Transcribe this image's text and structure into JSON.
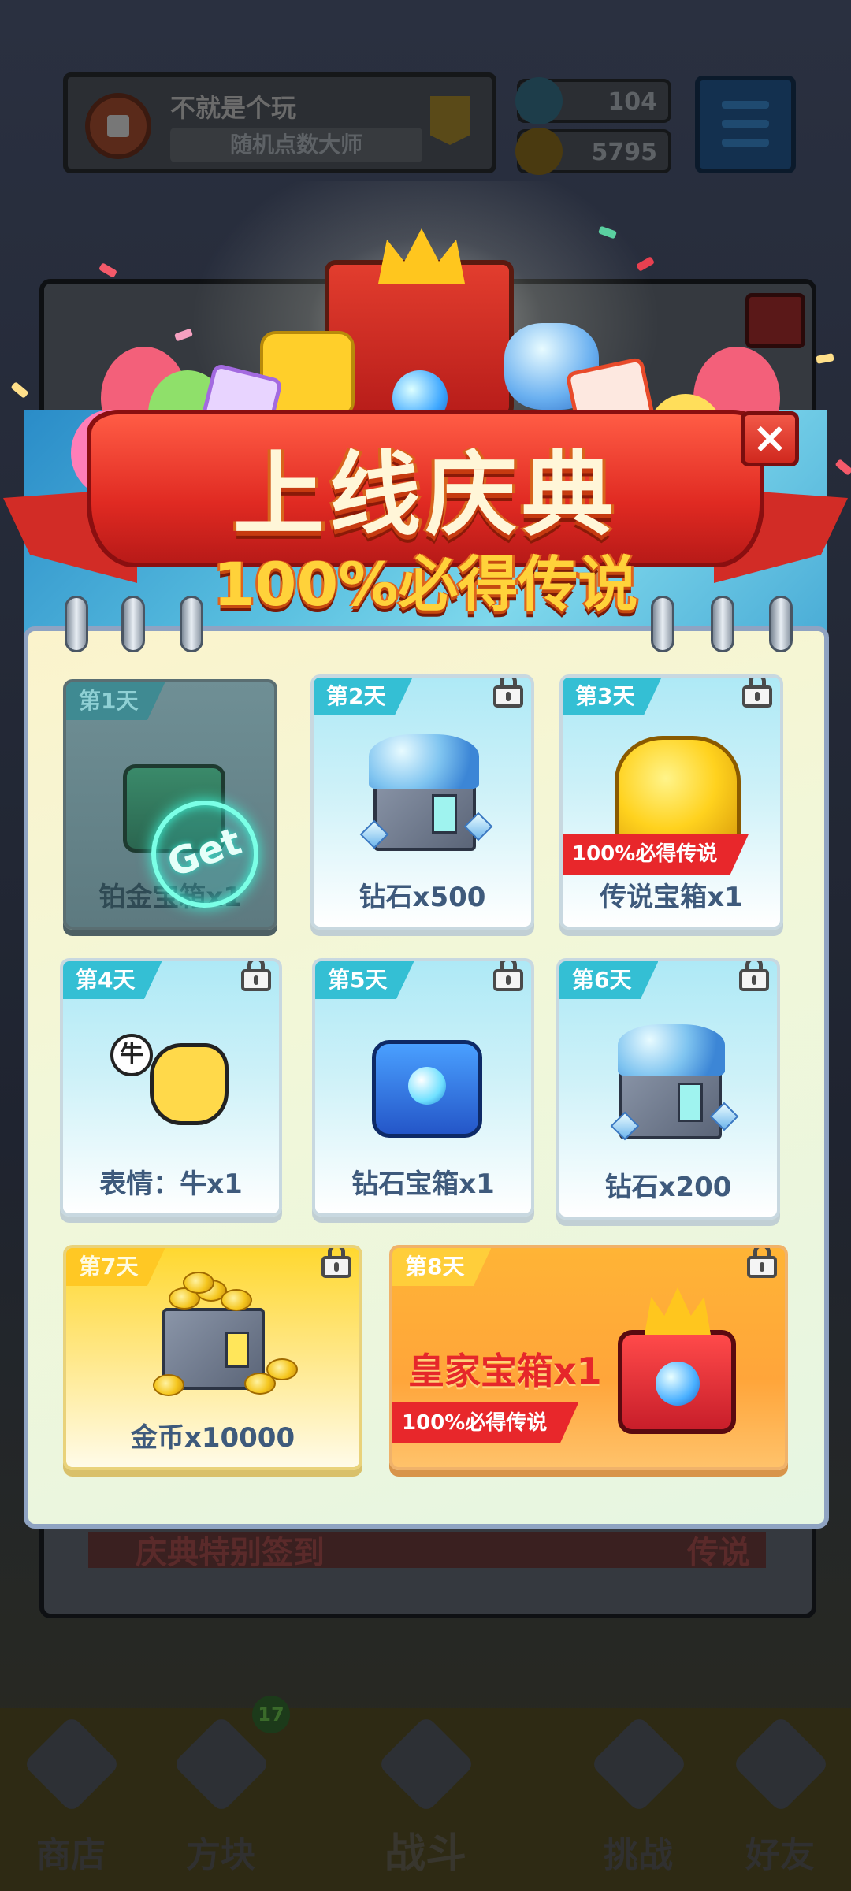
{
  "background": {
    "username": "不就是个玩",
    "title": "随机点数大师",
    "diamonds": "104",
    "coins": "5795",
    "banner_text": "庆典特别签到",
    "banner_side_text": "传说",
    "nav": [
      {
        "label": "商店"
      },
      {
        "label": "方块",
        "badge": "17"
      },
      {
        "label": "战斗"
      },
      {
        "label": "挑战"
      },
      {
        "label": "好友"
      }
    ]
  },
  "popup": {
    "title": "上线庆典",
    "subtitle": "100%必得传说",
    "close_icon": "×",
    "claim_label": "Get",
    "legend_tag": "100%必得传说",
    "days": [
      {
        "day": "第1天",
        "reward": "铂金宝箱x1",
        "state": "claimed"
      },
      {
        "day": "第2天",
        "reward": "钻石x500",
        "state": "locked"
      },
      {
        "day": "第3天",
        "reward": "传说宝箱x1",
        "state": "locked",
        "legend": true
      },
      {
        "day": "第4天",
        "reward": "表情：牛x1",
        "state": "locked"
      },
      {
        "day": "第5天",
        "reward": "钻石宝箱x1",
        "state": "locked"
      },
      {
        "day": "第6天",
        "reward": "钻石x200",
        "state": "locked"
      },
      {
        "day": "第7天",
        "reward": "金币x10000",
        "state": "locked"
      },
      {
        "day": "第8天",
        "reward": "皇家宝箱x1",
        "state": "locked",
        "legend": true
      }
    ],
    "emoji_char": "牛"
  },
  "colors": {
    "ribbon": "#e02a22",
    "title_text": "#fff6d8",
    "subtitle_text": "#ffd23a",
    "card_blue": "#aee9f6",
    "card_gold": "#ffd830",
    "card_orange": "#ffa53a",
    "legend_tag": "#e8272b"
  }
}
